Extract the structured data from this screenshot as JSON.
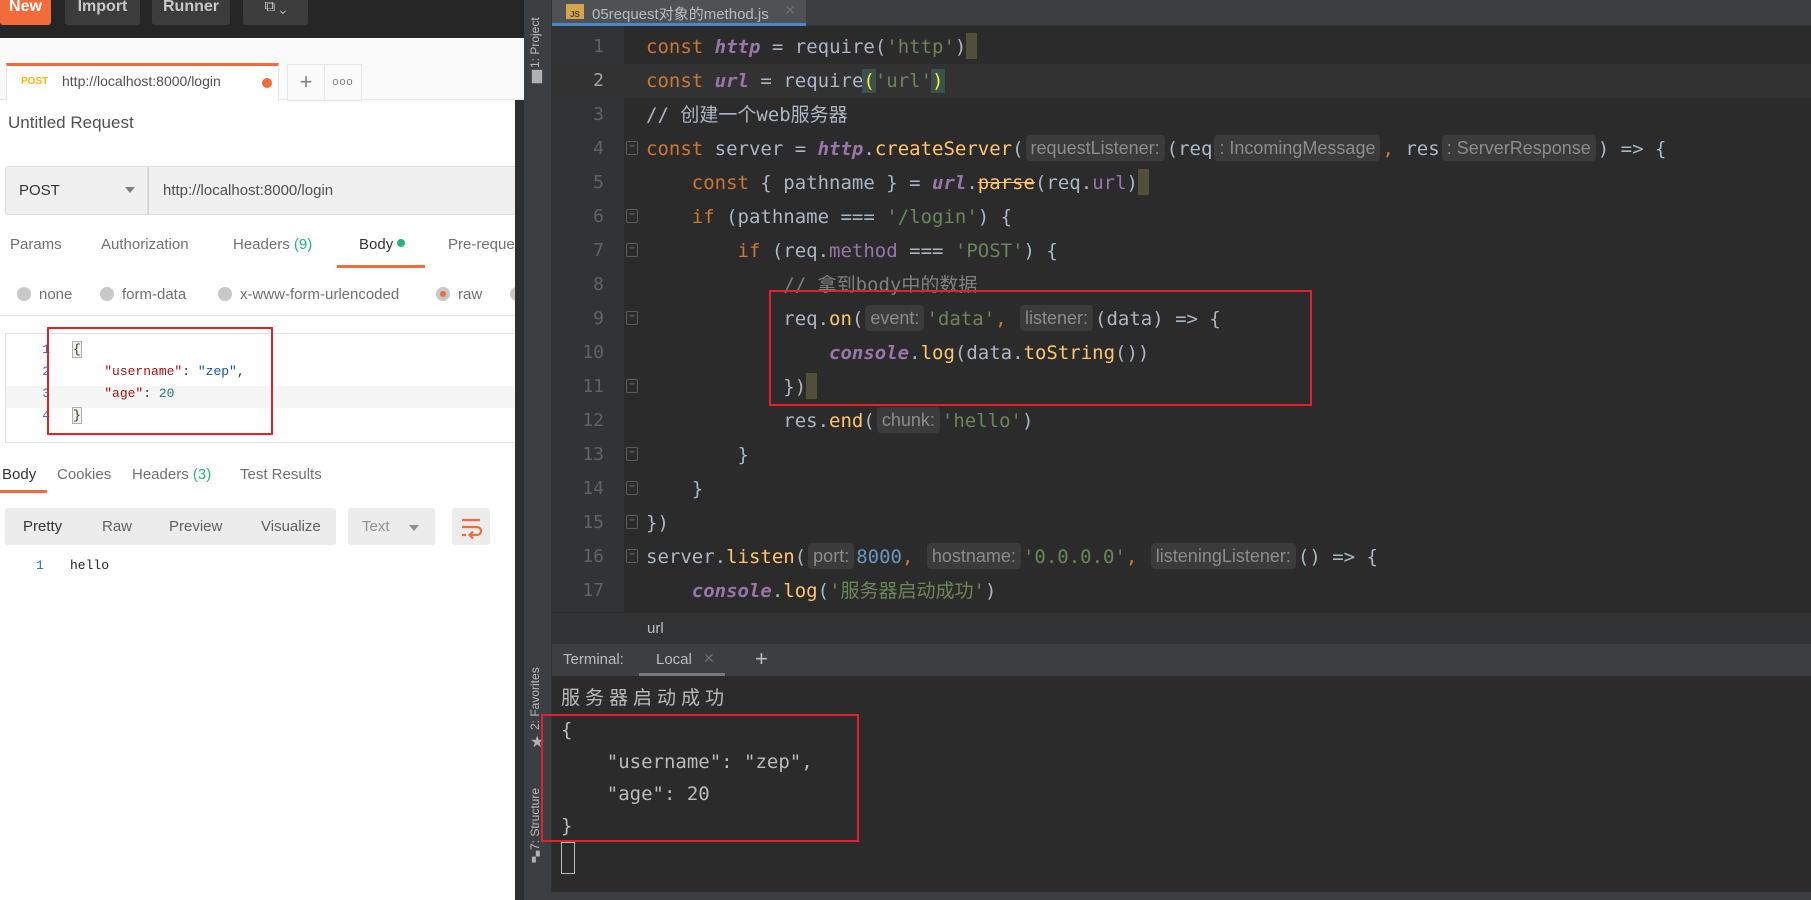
{
  "postman": {
    "toolbar": {
      "new_label": "New",
      "import_label": "Import",
      "runner_label": "Runner",
      "new_window_icon": "new-window-icon"
    },
    "request_tab": {
      "method": "POST",
      "url": "http://localhost:8000/login",
      "unsaved_dot": true,
      "add_tab_label": "+",
      "more_label": "ooo"
    },
    "request_title": "Untitled Request",
    "method_select": {
      "value": "POST"
    },
    "url_input": {
      "value": "http://localhost:8000/login"
    },
    "request_nav": [
      {
        "label": "Params"
      },
      {
        "label": "Authorization"
      },
      {
        "label": "Headers",
        "count": "(9)"
      },
      {
        "label": "Body",
        "active": true,
        "indicator": "green-dot"
      },
      {
        "label": "Pre-reques"
      }
    ],
    "body_types": [
      {
        "label": "none",
        "selected": false
      },
      {
        "label": "form-data",
        "selected": false
      },
      {
        "label": "x-www-form-urlencoded",
        "selected": false
      },
      {
        "label": "raw",
        "selected": true
      }
    ],
    "request_body": {
      "lines": [
        {
          "num": "1",
          "text": "{"
        },
        {
          "num": "2",
          "key": "\"username\"",
          "sep": ": ",
          "value": "\"zep\"",
          "end": ","
        },
        {
          "num": "3",
          "key": "\"age\"",
          "sep": ": ",
          "value": "20",
          "end": ""
        },
        {
          "num": "4",
          "text": "}"
        }
      ]
    },
    "response_nav": [
      {
        "label": "Body",
        "active": true
      },
      {
        "label": "Cookies"
      },
      {
        "label": "Headers",
        "count": "(3)"
      },
      {
        "label": "Test Results"
      }
    ],
    "view_modes": [
      "Pretty",
      "Raw",
      "Preview",
      "Visualize"
    ],
    "format_select": {
      "value": "Text"
    },
    "response_body": {
      "lines": [
        {
          "num": "1",
          "text": "hello"
        }
      ]
    }
  },
  "ide": {
    "tool_windows": {
      "project": "1: Project",
      "favorites": "2: Favorites",
      "structure": "7: Structure"
    },
    "file_tab": {
      "name": "05request对象的method.js",
      "icon_label": "JS"
    },
    "code_lines": [
      {
        "num": "1"
      },
      {
        "num": "2"
      },
      {
        "num": "3"
      },
      {
        "num": "4"
      },
      {
        "num": "5"
      },
      {
        "num": "6"
      },
      {
        "num": "7"
      },
      {
        "num": "8"
      },
      {
        "num": "9"
      },
      {
        "num": "10"
      },
      {
        "num": "11"
      },
      {
        "num": "12"
      },
      {
        "num": "13"
      },
      {
        "num": "14"
      },
      {
        "num": "15"
      },
      {
        "num": "16"
      },
      {
        "num": "17"
      }
    ],
    "code": {
      "l1": {
        "kw": "const",
        "var": "http",
        "op": " = ",
        "fn": "require",
        "open": "(",
        "str": "'http'",
        "close": ")"
      },
      "l2": {
        "kw": "const",
        "var": "url",
        "op": " = ",
        "fn": "require",
        "open": "(",
        "str": "'url'",
        "close": ")"
      },
      "l3": {
        "comment": "// 创建一个web服务器"
      },
      "l4": {
        "kw": "const",
        "name": " server = ",
        "obj": "http",
        "dot": ".",
        "fn": "createServer",
        "open": "(",
        "hint1": "requestListener:",
        "p1": "(req",
        "hint2": ": IncomingMessage",
        "comma": ", ",
        "p2": "res",
        "hint3": ": ServerResponse",
        "tail": ") => {"
      },
      "l5": {
        "kw": "const",
        "destr": " { pathname } = ",
        "obj": "url",
        "dot": ".",
        "fn": "parse",
        "args_open": "(req.",
        "prop": "url",
        "args_close": ")"
      },
      "l6": {
        "kw": "if",
        "cond": " (pathname === ",
        "str": "'/login'",
        "tail": ") {"
      },
      "l7": {
        "kw": "if",
        "cond": " (req.",
        "prop": "method",
        "op": " === ",
        "str": "'POST'",
        "tail": ") {"
      },
      "l8": {
        "comment": "// 拿到body中的数据"
      },
      "l9": {
        "obj": "req.",
        "fn": "on",
        "open": "(",
        "hint1": "event:",
        "str": "'data'",
        "comma": ",",
        "hint2": "listener:",
        "tail": "(data) => {"
      },
      "l10": {
        "obj": "console",
        "dot": ".",
        "fn": "log",
        "args_open": "(data.",
        "fn2": "toString",
        "args_close": "())"
      },
      "l11": {
        "text": "})"
      },
      "l12": {
        "obj": "res.",
        "fn": "end",
        "open": "(",
        "hint1": "chunk:",
        "str": "'hello'",
        "close": ")"
      },
      "l13": {
        "text": "}"
      },
      "l14": {
        "text": "}"
      },
      "l15": {
        "text": "})"
      },
      "l16": {
        "obj": "server.",
        "fn": "listen",
        "open": "(",
        "hint1": "port:",
        "num": "8000",
        "comma1": ",",
        "hint2": "hostname:",
        "str": "'0.0.0.0'",
        "comma2": ",",
        "hint3": "listeningListener:",
        "tail": "() => {"
      },
      "l17": {
        "obj": "console",
        "dot": ".",
        "fn": "log",
        "open": "(",
        "str": "'服务器启动成功'",
        "close": ")"
      }
    },
    "breadcrumb": "url",
    "terminal": {
      "label": "Terminal:",
      "tab_name": "Local",
      "add_label": "+",
      "lines": [
        "服务器启动成功",
        "{",
        "    \"username\": \"zep\",",
        "    \"age\": 20",
        "}"
      ]
    }
  },
  "colors": {
    "postman_accent": "#f26b3a",
    "postman_success": "#26b47f",
    "annotation_red": "#e3202d",
    "ide_keyword": "#cc7832",
    "ide_string": "#6a8759",
    "ide_function": "#ffc66d",
    "ide_global": "#9876aa"
  }
}
